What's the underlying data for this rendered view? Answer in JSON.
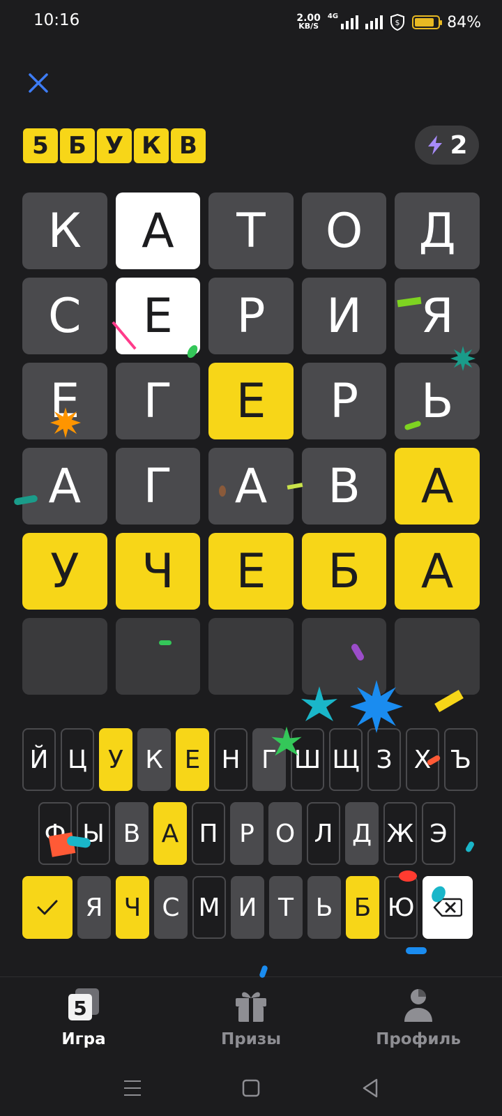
{
  "status_bar": {
    "time": "10:16",
    "net_speed_value": "2.00",
    "net_speed_unit": "KB/S",
    "network_type": "4G",
    "battery_percent": "84%",
    "battery_level": 0.84
  },
  "header": {
    "logo_letters": [
      "5",
      "Б",
      "У",
      "К",
      "В"
    ],
    "energy_count": "2"
  },
  "board": {
    "rows": [
      [
        {
          "letter": "К",
          "state": "gray"
        },
        {
          "letter": "А",
          "state": "white"
        },
        {
          "letter": "Т",
          "state": "gray"
        },
        {
          "letter": "О",
          "state": "gray"
        },
        {
          "letter": "Д",
          "state": "gray"
        }
      ],
      [
        {
          "letter": "С",
          "state": "gray"
        },
        {
          "letter": "Е",
          "state": "white"
        },
        {
          "letter": "Р",
          "state": "gray"
        },
        {
          "letter": "И",
          "state": "gray"
        },
        {
          "letter": "Я",
          "state": "gray"
        }
      ],
      [
        {
          "letter": "Е",
          "state": "gray"
        },
        {
          "letter": "Г",
          "state": "gray"
        },
        {
          "letter": "Е",
          "state": "yellow"
        },
        {
          "letter": "Р",
          "state": "gray"
        },
        {
          "letter": "Ь",
          "state": "gray"
        }
      ],
      [
        {
          "letter": "А",
          "state": "gray"
        },
        {
          "letter": "Г",
          "state": "gray"
        },
        {
          "letter": "А",
          "state": "gray"
        },
        {
          "letter": "В",
          "state": "gray"
        },
        {
          "letter": "А",
          "state": "yellow"
        }
      ],
      [
        {
          "letter": "У",
          "state": "yellow"
        },
        {
          "letter": "Ч",
          "state": "yellow"
        },
        {
          "letter": "Е",
          "state": "yellow"
        },
        {
          "letter": "Б",
          "state": "yellow"
        },
        {
          "letter": "А",
          "state": "yellow"
        }
      ],
      [
        {
          "letter": "",
          "state": "empty"
        },
        {
          "letter": "",
          "state": "empty"
        },
        {
          "letter": "",
          "state": "empty"
        },
        {
          "letter": "",
          "state": "empty"
        },
        {
          "letter": "",
          "state": "empty"
        }
      ]
    ]
  },
  "keyboard": {
    "row1": [
      {
        "key": "Й",
        "state": "none"
      },
      {
        "key": "Ц",
        "state": "none"
      },
      {
        "key": "У",
        "state": "yellow"
      },
      {
        "key": "К",
        "state": "gray"
      },
      {
        "key": "Е",
        "state": "yellow"
      },
      {
        "key": "Н",
        "state": "none"
      },
      {
        "key": "Г",
        "state": "gray"
      },
      {
        "key": "Ш",
        "state": "none"
      },
      {
        "key": "Щ",
        "state": "none"
      },
      {
        "key": "З",
        "state": "none"
      },
      {
        "key": "Х",
        "state": "none"
      },
      {
        "key": "Ъ",
        "state": "none"
      }
    ],
    "row2": [
      {
        "key": "Ф",
        "state": "none"
      },
      {
        "key": "Ы",
        "state": "none"
      },
      {
        "key": "В",
        "state": "gray"
      },
      {
        "key": "А",
        "state": "yellow"
      },
      {
        "key": "П",
        "state": "none"
      },
      {
        "key": "Р",
        "state": "gray"
      },
      {
        "key": "О",
        "state": "gray"
      },
      {
        "key": "Л",
        "state": "none"
      },
      {
        "key": "Д",
        "state": "gray"
      },
      {
        "key": "Ж",
        "state": "none"
      },
      {
        "key": "Э",
        "state": "none"
      }
    ],
    "row3": [
      {
        "key": "Я",
        "state": "gray"
      },
      {
        "key": "Ч",
        "state": "yellow"
      },
      {
        "key": "С",
        "state": "gray"
      },
      {
        "key": "М",
        "state": "none"
      },
      {
        "key": "И",
        "state": "gray"
      },
      {
        "key": "Т",
        "state": "gray"
      },
      {
        "key": "Ь",
        "state": "gray"
      },
      {
        "key": "Б",
        "state": "yellow"
      },
      {
        "key": "Ю",
        "state": "none"
      }
    ],
    "submit_icon": "check-icon",
    "backspace_icon": "backspace-icon"
  },
  "tabs": [
    {
      "label": "Игра",
      "icon": "game-icon",
      "active": true
    },
    {
      "label": "Призы",
      "icon": "gift-icon",
      "active": false
    },
    {
      "label": "Профиль",
      "icon": "profile-icon",
      "active": false
    }
  ],
  "colors": {
    "background": "#1c1c1e",
    "tile_gray": "#4a4a4d",
    "tile_empty": "#3a3a3c",
    "accent_yellow": "#f7d618",
    "close_blue": "#3d7cf5",
    "energy_purple": "#a78bfa"
  }
}
